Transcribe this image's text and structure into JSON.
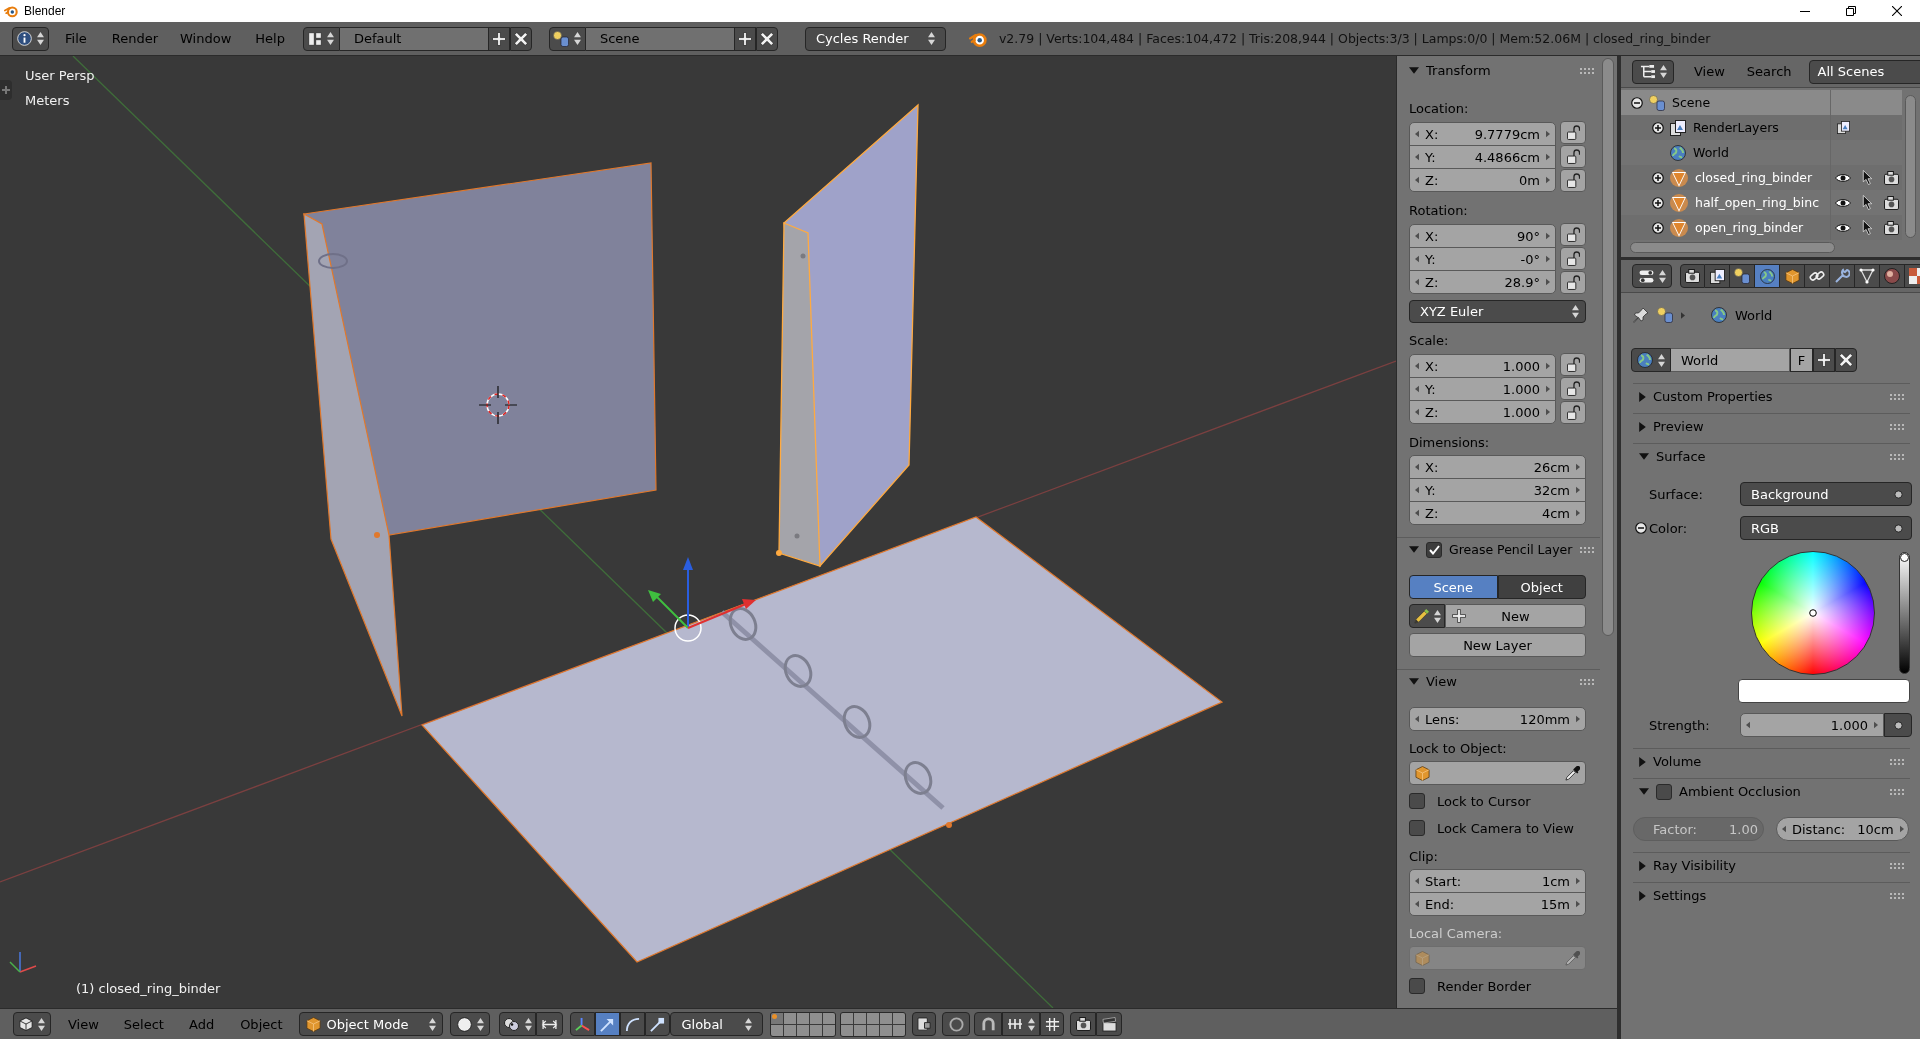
{
  "window": {
    "title": "Blender"
  },
  "info_header": {
    "menus": [
      "File",
      "Render",
      "Window",
      "Help"
    ],
    "screen_layout": "Default",
    "scene": "Scene",
    "render_engine": "Cycles Render",
    "stats": "v2.79 | Verts:104,484 | Faces:104,472 | Tris:208,944 | Objects:3/3 | Lamps:0/0 | Mem:52.06M | closed_ring_binder"
  },
  "viewport": {
    "view_name": "User Persp",
    "units": "Meters",
    "active_object": "(1) closed_ring_binder"
  },
  "n_panel": [
    {
      "title": "Transform",
      "expanded": true,
      "items": [
        {
          "kind": "label",
          "text": "Location:"
        },
        {
          "kind": "vector",
          "fields": [
            {
              "axis": "X:",
              "value": "9.7779cm",
              "locked": false
            },
            {
              "axis": "Y:",
              "value": "4.4866cm",
              "locked": false
            },
            {
              "axis": "Z:",
              "value": "0m",
              "locked": false
            }
          ]
        },
        {
          "kind": "label",
          "text": "Rotation:"
        },
        {
          "kind": "vector",
          "fields": [
            {
              "axis": "X:",
              "value": "90°",
              "locked": false
            },
            {
              "axis": "Y:",
              "value": "-0°",
              "locked": false
            },
            {
              "axis": "Z:",
              "value": "28.9°",
              "locked": false
            }
          ]
        },
        {
          "kind": "dropdown",
          "value": "XYZ Euler"
        },
        {
          "kind": "label",
          "text": "Scale:"
        },
        {
          "kind": "vector",
          "fields": [
            {
              "axis": "X:",
              "value": "1.000",
              "locked": false
            },
            {
              "axis": "Y:",
              "value": "1.000",
              "locked": false
            },
            {
              "axis": "Z:",
              "value": "1.000",
              "locked": false
            }
          ]
        },
        {
          "kind": "label",
          "text": "Dimensions:"
        },
        {
          "kind": "vector",
          "fields": [
            {
              "axis": "X:",
              "value": "26cm"
            },
            {
              "axis": "Y:",
              "value": "32cm"
            },
            {
              "axis": "Z:",
              "value": "4cm"
            }
          ]
        }
      ]
    },
    {
      "title": "Grease Pencil Layer",
      "expanded": true,
      "checked": true,
      "items": [
        {
          "kind": "toggle",
          "options": [
            {
              "label": "Scene",
              "selected": true
            },
            {
              "label": "Object",
              "selected": false
            }
          ]
        },
        {
          "kind": "new",
          "text": "New"
        },
        {
          "kind": "button",
          "text": "New Layer"
        }
      ]
    },
    {
      "title": "View",
      "expanded": true,
      "items": [
        {
          "kind": "number",
          "label": "Lens:",
          "value": "120mm"
        },
        {
          "kind": "label",
          "text": "Lock to Object:",
          "disabled": false
        },
        {
          "kind": "object_field",
          "disabled": false
        },
        {
          "kind": "checkbox",
          "text": "Lock to Cursor",
          "checked": false
        },
        {
          "kind": "checkbox",
          "text": "Lock Camera to View",
          "checked": false
        },
        {
          "kind": "label",
          "text": "Clip:",
          "disabled": false
        },
        {
          "kind": "number_column",
          "fields": [
            {
              "label": "Start:",
              "value": "1cm"
            },
            {
              "label": "End:",
              "value": "15m"
            }
          ]
        },
        {
          "kind": "label",
          "text": "Local Camera:",
          "disabled": true
        },
        {
          "kind": "object_field",
          "disabled": true
        },
        {
          "kind": "checkbox",
          "text": "Render Border",
          "checked": false
        }
      ]
    }
  ],
  "view3d_header": {
    "menus": [
      "View",
      "Select",
      "Add",
      "Object"
    ],
    "mode": "Object Mode",
    "manipulators": [
      {
        "kind": "translate",
        "selected": true
      },
      {
        "kind": "rotate",
        "selected": false
      },
      {
        "kind": "scale",
        "selected": false
      }
    ],
    "orientation": "Global",
    "layers": [
      {
        "selected": true,
        "has_objects": true
      },
      {
        "selected": false,
        "has_objects": false
      },
      {
        "selected": false,
        "has_objects": false
      },
      {
        "selected": false,
        "has_objects": false
      },
      {
        "selected": false,
        "has_objects": false
      },
      {
        "selected": false,
        "has_objects": false
      },
      {
        "selected": false,
        "has_objects": false
      },
      {
        "selected": false,
        "has_objects": false
      },
      {
        "selected": false,
        "has_objects": false
      },
      {
        "selected": false,
        "has_objects": false
      },
      {
        "selected": false,
        "has_objects": false
      },
      {
        "selected": false,
        "has_objects": false
      },
      {
        "selected": false,
        "has_objects": false
      },
      {
        "selected": false,
        "has_objects": false
      },
      {
        "selected": false,
        "has_objects": false
      },
      {
        "selected": false,
        "has_objects": false
      },
      {
        "selected": false,
        "has_objects": false
      },
      {
        "selected": false,
        "has_objects": false
      },
      {
        "selected": false,
        "has_objects": false
      },
      {
        "selected": false,
        "has_objects": false
      }
    ]
  },
  "outliner": {
    "menus": [
      "View",
      "Search"
    ],
    "display_mode": "All Scenes",
    "tree": [
      {
        "kind": "scene",
        "label": "Scene",
        "expanded": true,
        "active": true,
        "selected": false,
        "children": [
          {
            "kind": "render_layers",
            "label": "RenderLayers",
            "expanded": false,
            "active": false,
            "selected": false
          },
          {
            "kind": "world",
            "label": "World",
            "active": false,
            "selected": false
          },
          {
            "kind": "mesh_object",
            "label": "closed_ring_binder",
            "expanded": false,
            "active": false,
            "selected": true
          },
          {
            "kind": "mesh_object",
            "label": "half_open_ring_binc",
            "expanded": false,
            "active": false,
            "selected": true
          },
          {
            "kind": "mesh_object",
            "label": "open_ring_binder",
            "expanded": false,
            "active": false,
            "selected": true
          }
        ]
      }
    ]
  },
  "properties": {
    "context_tabs": [
      {
        "kind": "render",
        "selected": false
      },
      {
        "kind": "render_layers",
        "selected": false
      },
      {
        "kind": "scene",
        "selected": false
      },
      {
        "kind": "world",
        "selected": true
      },
      {
        "kind": "object",
        "selected": false
      },
      {
        "kind": "constraints",
        "selected": false
      },
      {
        "kind": "modifiers",
        "selected": false
      },
      {
        "kind": "data",
        "selected": false
      },
      {
        "kind": "material",
        "selected": false
      },
      {
        "kind": "texture",
        "selected": false
      }
    ],
    "breadcrumb": "World",
    "datablock": {
      "name": "World",
      "fake_user": "F"
    },
    "panels": [
      {
        "title": "Custom Properties",
        "expanded": false
      },
      {
        "title": "Preview",
        "expanded": false
      },
      {
        "title": "Surface",
        "expanded": true,
        "items": [
          {
            "kind": "labeled_dropdown",
            "label": "Surface:",
            "value": "Background"
          },
          {
            "kind": "labeled_dropdown",
            "label": "Color:",
            "value": "RGB",
            "expanded": true
          },
          {
            "kind": "color_picker",
            "level": 1
          },
          {
            "kind": "labeled_number",
            "label": "Strength:",
            "value": "1.000"
          }
        ]
      },
      {
        "title": "Volume",
        "expanded": false
      },
      {
        "title": "Ambient Occlusion",
        "expanded": true,
        "checked": false,
        "items": [
          {
            "kind": "number_pair",
            "fields": [
              {
                "label": "Factor:",
                "value": "1.00",
                "disabled": true
              },
              {
                "label": "Distanc:",
                "value": "10cm",
                "disabled": false
              }
            ]
          }
        ]
      },
      {
        "title": "Ray Visibility",
        "expanded": false
      },
      {
        "title": "Settings",
        "expanded": false
      }
    ]
  }
}
